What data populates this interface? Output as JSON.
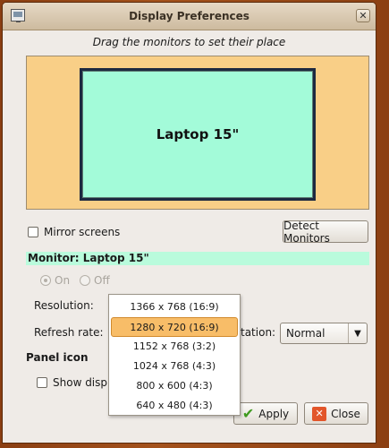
{
  "window": {
    "title": "Display Preferences"
  },
  "instruction": "Drag the monitors to set their place",
  "monitor_box": {
    "label": "Laptop 15\""
  },
  "mirror_screens": {
    "label": "Mirror screens",
    "checked": false
  },
  "detect_button": {
    "label": "Detect Monitors"
  },
  "monitor_header": "Monitor: Laptop 15\"",
  "power": {
    "on_label": "On",
    "off_label": "Off",
    "selected": "On"
  },
  "resolution": {
    "label": "Resolution:",
    "options": [
      "1366 x 768 (16:9)",
      "1280 x 720 (16:9)",
      "1152 x 768 (3:2)",
      "1024 x 768 (4:3)",
      "800 x 600 (4:3)",
      "640 x 480 (4:3)"
    ],
    "selected": "1280 x 720 (16:9)"
  },
  "refresh_rate": {
    "label": "Refresh rate:"
  },
  "rotation": {
    "label_visible": "tation:",
    "value": "Normal"
  },
  "panel_icon": {
    "heading": "Panel icon",
    "show_label_visible": "Show displa",
    "checked": false
  },
  "buttons": {
    "apply": "Apply",
    "close": "Close"
  },
  "colors": {
    "canvas": "#f9cf87",
    "monitor": "#a3fbd9",
    "header": "#b9fbdc",
    "selection": "#f8bd68"
  }
}
